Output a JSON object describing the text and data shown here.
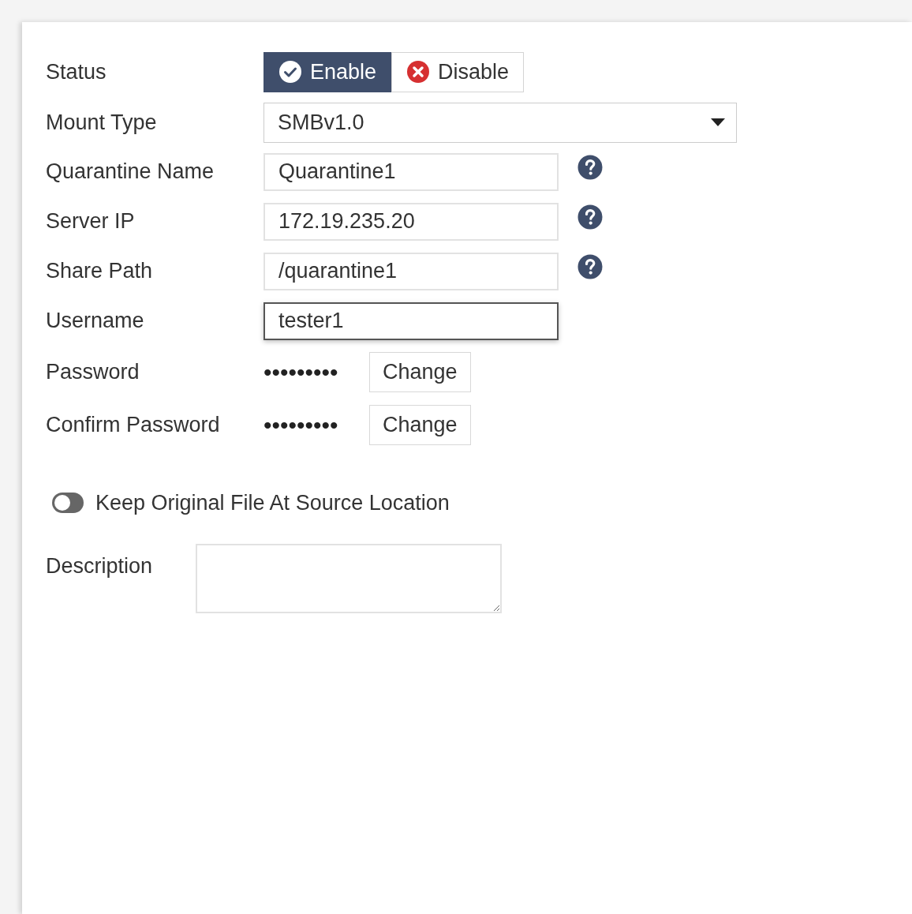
{
  "status": {
    "label": "Status",
    "options": [
      {
        "label": "Enable",
        "kind": "enable",
        "selected": true
      },
      {
        "label": "Disable",
        "kind": "disable",
        "selected": false
      }
    ]
  },
  "mount_type": {
    "label": "Mount Type",
    "value": "SMBv1.0"
  },
  "fields": [
    {
      "label": "Quarantine Name",
      "value": "Quarantine1",
      "help": true,
      "focused": false
    },
    {
      "label": "Server IP",
      "value": "172.19.235.20",
      "help": true,
      "focused": false
    },
    {
      "label": "Share Path",
      "value": "/quarantine1",
      "help": true,
      "focused": false
    },
    {
      "label": "Username",
      "value": "tester1",
      "help": false,
      "focused": true
    }
  ],
  "passwords": [
    {
      "label": "Password",
      "masked": "•••••••••",
      "button": "Change"
    },
    {
      "label": "Confirm Password",
      "masked": "•••••••••",
      "button": "Change"
    }
  ],
  "keep_original": {
    "label": "Keep Original File At Source Location",
    "on": false
  },
  "description": {
    "label": "Description"
  }
}
